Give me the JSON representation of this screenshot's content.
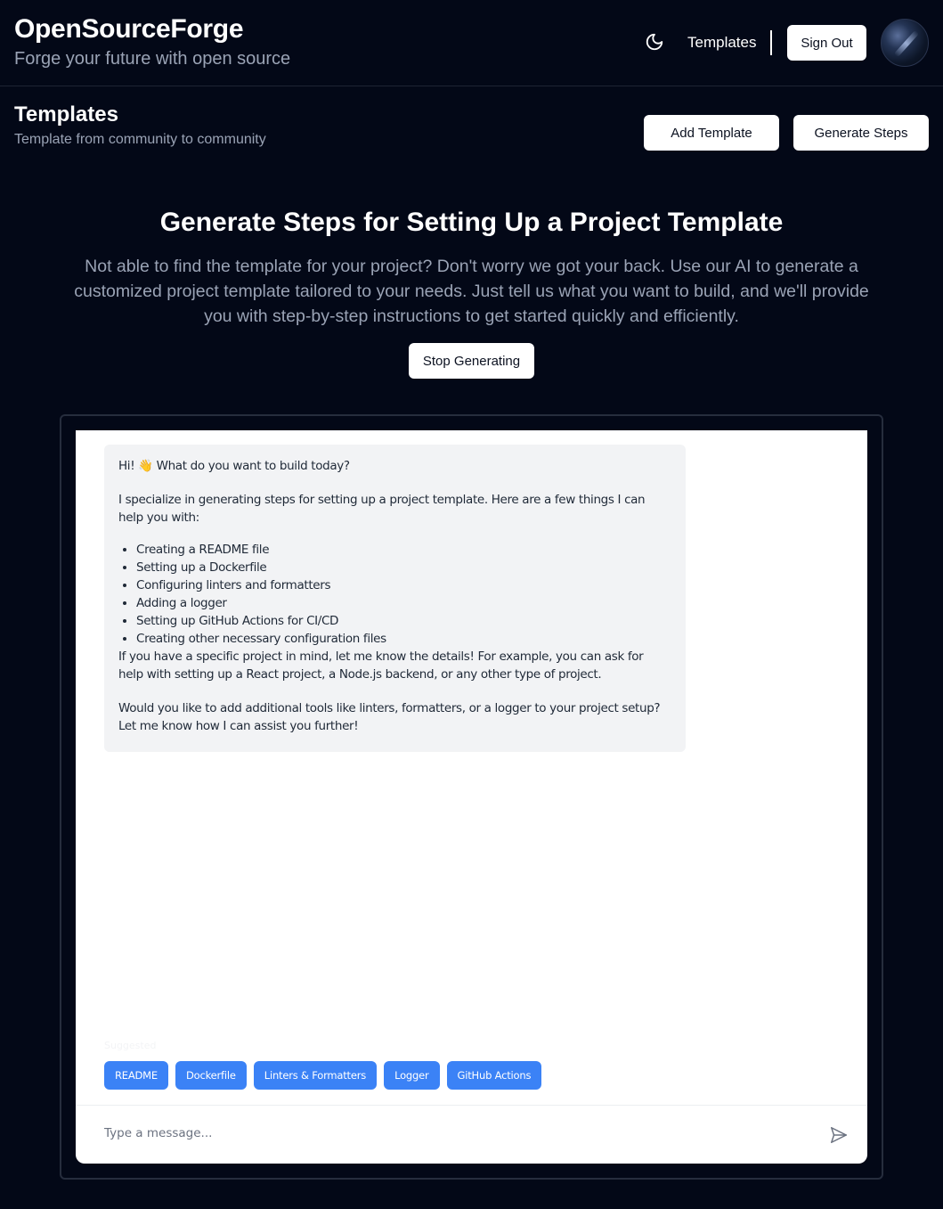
{
  "header": {
    "brand_title": "OpenSourceForge",
    "brand_tagline": "Forge your future with open source",
    "theme_icon": "moon-icon",
    "nav_templates": "Templates",
    "sign_out": "Sign Out",
    "avatar_icon": "avatar"
  },
  "page": {
    "title": "Templates",
    "subtitle": "Template from community to community",
    "add_template": "Add Template",
    "generate_steps": "Generate Steps"
  },
  "hero": {
    "title": "Generate Steps for Setting Up a Project Template",
    "description": "Not able to find the template for your project? Don't worry we got your back. Use our AI to generate a customized project template tailored to your needs. Just tell us what you want to build, and we'll provide you with step-by-step instructions to get started quickly and efficiently.",
    "stop_button": "Stop Generating"
  },
  "chat": {
    "message": {
      "greeting": "Hi! 👋 What do you want to build today?",
      "intro": "I specialize in generating steps for setting up a project template. Here are a few things I can help you with:",
      "items": [
        "Creating a README file",
        "Setting up a Dockerfile",
        "Configuring linters and formatters",
        "Adding a logger",
        "Setting up GitHub Actions for CI/CD",
        "Creating other necessary configuration files"
      ],
      "followup": "If you have a specific project in mind, let me know the details! For example, you can ask for help with setting up a React project, a Node.js backend, or any other type of project.",
      "closing": "Would you like to add additional tools like linters, formatters, or a logger to your project setup? Let me know how I can assist you further!"
    },
    "suggested_label": "Suggested",
    "chips": [
      "README",
      "Dockerfile",
      "Linters & Formatters",
      "Logger",
      "GitHub Actions"
    ],
    "input_placeholder": "Type a message...",
    "send_icon": "send-icon"
  },
  "colors": {
    "background": "#030817",
    "accent_chip": "#3b82f6",
    "muted_text": "#9aa3b5",
    "bubble": "#f2f3f5"
  }
}
